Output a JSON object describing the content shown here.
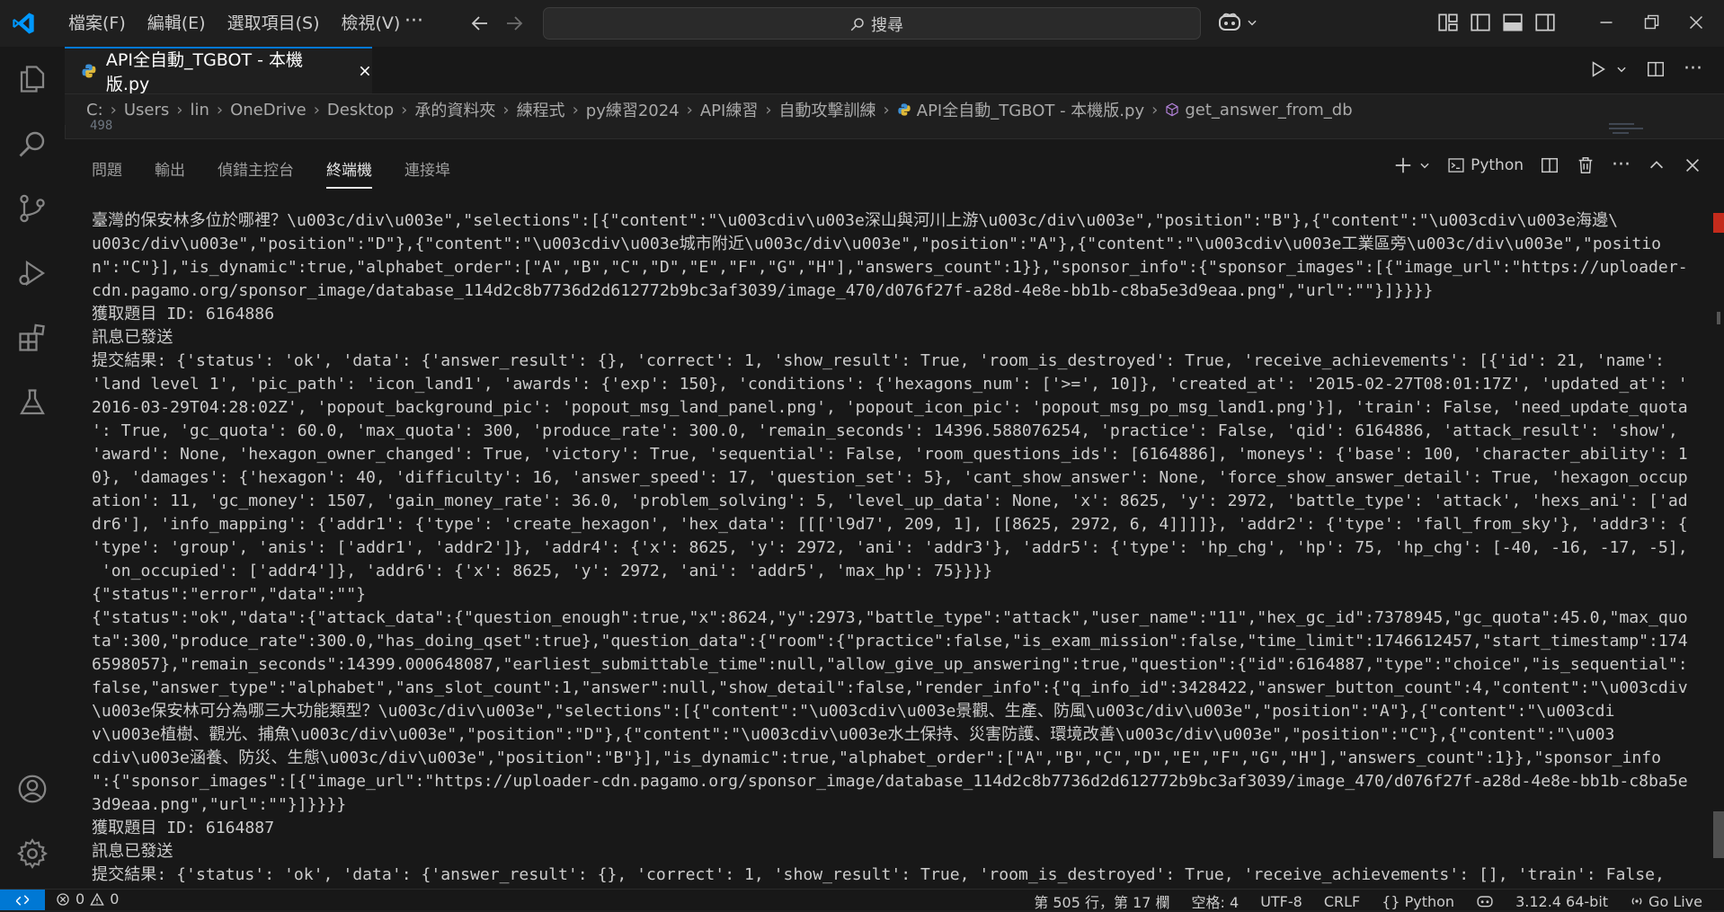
{
  "menu": [
    "檔案(F)",
    "編輯(E)",
    "選取項目(S)",
    "檢視(V)"
  ],
  "menu_more": "···",
  "search": {
    "label": "搜尋"
  },
  "tab": {
    "label": "API全自動_TGBOT - 本機版.py"
  },
  "breadcrumb": [
    "C:",
    "Users",
    "lin",
    "OneDrive",
    "Desktop",
    "承的資料夾",
    "練程式",
    "py練習2024",
    "API練習",
    "自動攻擊訓練",
    "API全自動_TGBOT - 本機版.py",
    "get_answer_from_db"
  ],
  "line_peek": "498",
  "panel_tabs": [
    "問題",
    "輸出",
    "偵錯主控台",
    "終端機",
    "連接埠"
  ],
  "panel_active": "終端機",
  "terminal_profile": "Python",
  "terminal_lines": [
    "臺灣的保安林多位於哪裡？\\u003c/div\\u003e\",\"selections\":[{\"content\":\"\\u003cdiv\\u003e深山與河川上游\\u003c/div\\u003e\",\"position\":\"B\"},{\"content\":\"\\u003cdiv\\u003e海邊\\",
    "u003c/div\\u003e\",\"position\":\"D\"},{\"content\":\"\\u003cdiv\\u003e城市附近\\u003c/div\\u003e\",\"position\":\"A\"},{\"content\":\"\\u003cdiv\\u003e工業區旁\\u003c/div\\u003e\",\"positio",
    "n\":\"C\"}],\"is_dynamic\":true,\"alphabet_order\":[\"A\",\"B\",\"C\",\"D\",\"E\",\"F\",\"G\",\"H\"],\"answers_count\":1}},\"sponsor_info\":{\"sponsor_images\":[{\"image_url\":\"https://uploader-",
    "cdn.pagamo.org/sponsor_image/database_114d2c8b7736d2d612772b9bc3af3039/image_470/d076f27f-a28d-4e8e-bb1b-c8ba5e3d9eaa.png\",\"url\":\"\"}]}}}}",
    "獲取題目 ID: 6164886",
    "訊息已發送",
    "提交結果: {'status': 'ok', 'data': {'answer_result': {}, 'correct': 1, 'show_result': True, 'room_is_destroyed': True, 'receive_achievements': [{'id': 21, 'name':",
    "'land level 1', 'pic_path': 'icon_land1', 'awards': {'exp': 150}, 'conditions': {'hexagons_num': ['>=', 10]}, 'created_at': '2015-02-27T08:01:17Z', 'updated_at': '",
    "2016-03-29T04:28:02Z', 'popout_background_pic': 'popout_msg_land_panel.png', 'popout_icon_pic': 'popout_msg_po_msg_land1.png'}], 'train': False, 'need_update_quota",
    "': True, 'gc_quota': 60.0, 'max_quota': 300, 'produce_rate': 300.0, 'remain_seconds': 14396.588076254, 'practice': False, 'qid': 6164886, 'attack_result': 'show',",
    "'award': None, 'hexagon_owner_changed': True, 'victory': True, 'sequential': False, 'room_questions_ids': [6164886], 'moneys': {'base': 100, 'character_ability': 1",
    "0}, 'damages': {'hexagon': 40, 'difficulty': 16, 'answer_speed': 17, 'question_set': 5}, 'cant_show_answer': None, 'force_show_answer_detail': True, 'hexagon_occup",
    "ation': 11, 'gc_money': 1507, 'gain_money_rate': 36.0, 'problem_solving': 5, 'level_up_data': None, 'x': 8625, 'y': 2972, 'battle_type': 'attack', 'hexs_ani': ['ad",
    "dr6'], 'info_mapping': {'addr1': {'type': 'create_hexagon', 'hex_data': [[['l9d7', 209, 1], [[8625, 2972, 6, 4]]]]}, 'addr2': {'type': 'fall_from_sky'}, 'addr3': {",
    "'type': 'group', 'anis': ['addr1', 'addr2']}, 'addr4': {'x': 8625, 'y': 2972, 'ani': 'addr3'}, 'addr5': {'type': 'hp_chg', 'hp': 75, 'hp_chg': [-40, -16, -17, -5],",
    " 'on_occupied': ['addr4']}, 'addr6': {'x': 8625, 'y': 2972, 'ani': 'addr5', 'max_hp': 75}}}}",
    "{\"status\":\"error\",\"data\":\"\"}",
    "{\"status\":\"ok\",\"data\":{\"attack_data\":{\"question_enough\":true,\"x\":8624,\"y\":2973,\"battle_type\":\"attack\",\"user_name\":\"11\",\"hex_gc_id\":7378945,\"gc_quota\":45.0,\"max_quo",
    "ta\":300,\"produce_rate\":300.0,\"has_doing_qset\":true},\"question_data\":{\"room\":{\"practice\":false,\"is_exam_mission\":false,\"time_limit\":1746612457,\"start_timestamp\":174",
    "6598057},\"remain_seconds\":14399.000648087,\"earliest_submittable_time\":null,\"allow_give_up_answering\":true,\"question\":{\"id\":6164887,\"type\":\"choice\",\"is_sequential\":",
    "false,\"answer_type\":\"alphabet\",\"ans_slot_count\":1,\"answer\":null,\"show_detail\":false,\"render_info\":{\"q_info_id\":3428422,\"answer_button_count\":4,\"content\":\"\\u003cdiv",
    "\\u003e保安林可分為哪三大功能類型？\\u003c/div\\u003e\",\"selections\":[{\"content\":\"\\u003cdiv\\u003e景觀、生產、防風\\u003c/div\\u003e\",\"position\":\"A\"},{\"content\":\"\\u003cdi",
    "v\\u003e植樹、觀光、捕魚\\u003c/div\\u003e\",\"position\":\"D\"},{\"content\":\"\\u003cdiv\\u003e水土保持、災害防護、環境改善\\u003c/div\\u003e\",\"position\":\"C\"},{\"content\":\"\\u003",
    "cdiv\\u003e涵養、防災、生態\\u003c/div\\u003e\",\"position\":\"B\"}],\"is_dynamic\":true,\"alphabet_order\":[\"A\",\"B\",\"C\",\"D\",\"E\",\"F\",\"G\",\"H\"],\"answers_count\":1}},\"sponsor_info",
    "\":{\"sponsor_images\":[{\"image_url\":\"https://uploader-cdn.pagamo.org/sponsor_image/database_114d2c8b7736d2d612772b9bc3af3039/image_470/d076f27f-a28d-4e8e-bb1b-c8ba5e",
    "3d9eaa.png\",\"url\":\"\"}]}}}}",
    "獲取題目 ID: 6164887",
    "訊息已發送",
    "提交結果: {'status': 'ok', 'data': {'answer_result': {}, 'correct': 1, 'show_result': True, 'room_is_destroyed': True, 'receive_achievements': [], 'train': False,"
  ],
  "status": {
    "errors": "0",
    "warnings": "0",
    "position": "第 505 行，第 17 欄",
    "spaces": "空格: 4",
    "encoding": "UTF-8",
    "eol": "CRLF",
    "language": "Python",
    "interpreter": "3.12.4 64-bit",
    "golive": "Go Live"
  },
  "colors": {
    "accent": "#0078d4",
    "background": "#1f1f1f",
    "panel": "#181818",
    "text": "#cccccc"
  }
}
